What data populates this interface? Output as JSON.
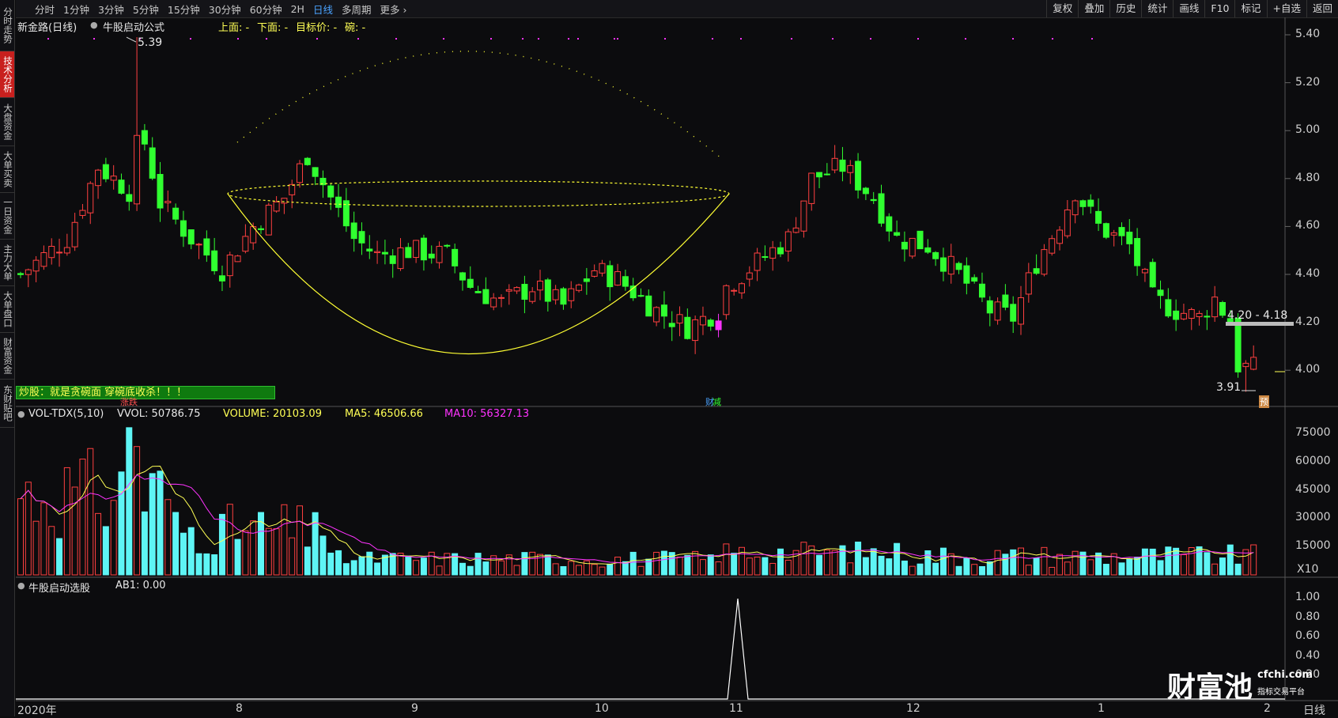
{
  "sidebar": {
    "tabs": [
      "分时走势",
      "技术分析",
      "大盘资金",
      "大单买卖",
      "一日资金",
      "主力大单",
      "大单盘口",
      "财富资金",
      "东财贴吧"
    ],
    "active_index": 1
  },
  "toolbar": {
    "periods": [
      "分时",
      "1分钟",
      "3分钟",
      "5分钟",
      "15分钟",
      "30分钟",
      "60分钟",
      "2H",
      "日线",
      "多周期",
      "更多"
    ],
    "active_period": "日线",
    "tools": [
      "复权",
      "叠加",
      "历史",
      "统计",
      "画线",
      "F10",
      "标记",
      "+自选",
      "返回"
    ]
  },
  "header": {
    "stock_name": "新金路(日线)",
    "formula": "牛股启动公式",
    "upper": "上面: -",
    "lower": "下面: -",
    "target": "目标价: -",
    "bowl": "碗: -"
  },
  "price_chart": {
    "high_label": "5.39",
    "low_label": "3.91",
    "range_label": "4.20 - 4.18",
    "y_ticks": [
      "5.40",
      "5.20",
      "5.00",
      "4.80",
      "4.60",
      "4.40",
      "4.20",
      "4.00"
    ],
    "banner": "炒股：就是贪碗面 穿碗底收杀！！！",
    "marker_zd": "涨跌",
    "marker_cai": "财",
    "marker_jian": "减",
    "marker_yu": "预"
  },
  "volume_panel": {
    "title": "VOL-TDX(5,10)",
    "vvol": "VVOL: 50786.75",
    "volume": "VOLUME: 20103.09",
    "ma5": "MA5: 46506.66",
    "ma10": "MA10: 56327.13",
    "y_ticks": [
      "75000",
      "60000",
      "45000",
      "30000",
      "15000"
    ],
    "unit": "X10"
  },
  "signal_panel": {
    "title": "牛股启动选股",
    "ab1": "AB1: 0.00",
    "y_ticks": [
      "1.00",
      "0.80",
      "0.60",
      "0.40",
      "0.20"
    ]
  },
  "x_axis": {
    "labels": [
      "2020年",
      "8",
      "9",
      "10",
      "11",
      "12",
      "1",
      "2"
    ],
    "period_label": "日线"
  },
  "watermark": {
    "brand": "财富池",
    "site": "cfchi.com",
    "slogan": "指标交易平台"
  },
  "colors": {
    "up": "#ff4040",
    "down": "#30ff30",
    "vol_down": "#5ef5f5",
    "ma5": "#ffff55",
    "ma10": "#ff33ff",
    "bowl": "#ffff33"
  }
}
